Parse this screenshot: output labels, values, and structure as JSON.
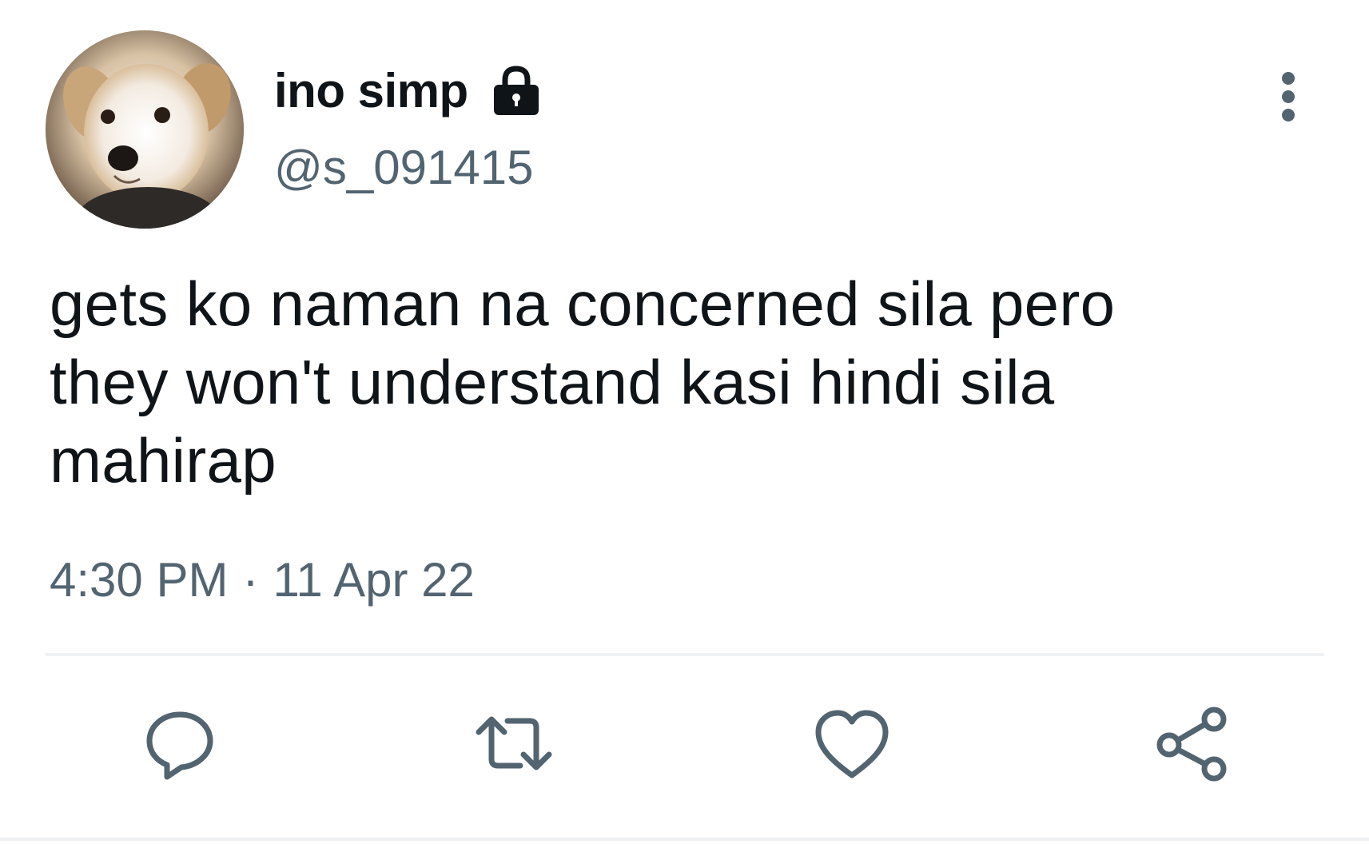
{
  "tweet": {
    "display_name": "ino simp",
    "handle": "@s_091415",
    "text_lines": [
      "gets ko naman na concerned sila pero",
      "they won't understand kasi hindi sila",
      "mahirap"
    ],
    "time": "4:30 PM",
    "dot": "·",
    "date": "11 Apr 22"
  },
  "icons": {
    "avatar": "dog-avatar",
    "protected": "lock-icon",
    "more": "more-vertical-icon",
    "reply": "reply-icon",
    "retweet": "retweet-icon",
    "like": "heart-icon",
    "share": "share-icon"
  },
  "colors": {
    "text_primary": "#0f1419",
    "text_secondary": "#536471",
    "icon": "#536471",
    "divider": "#eff1f3",
    "background": "#ffffff"
  }
}
